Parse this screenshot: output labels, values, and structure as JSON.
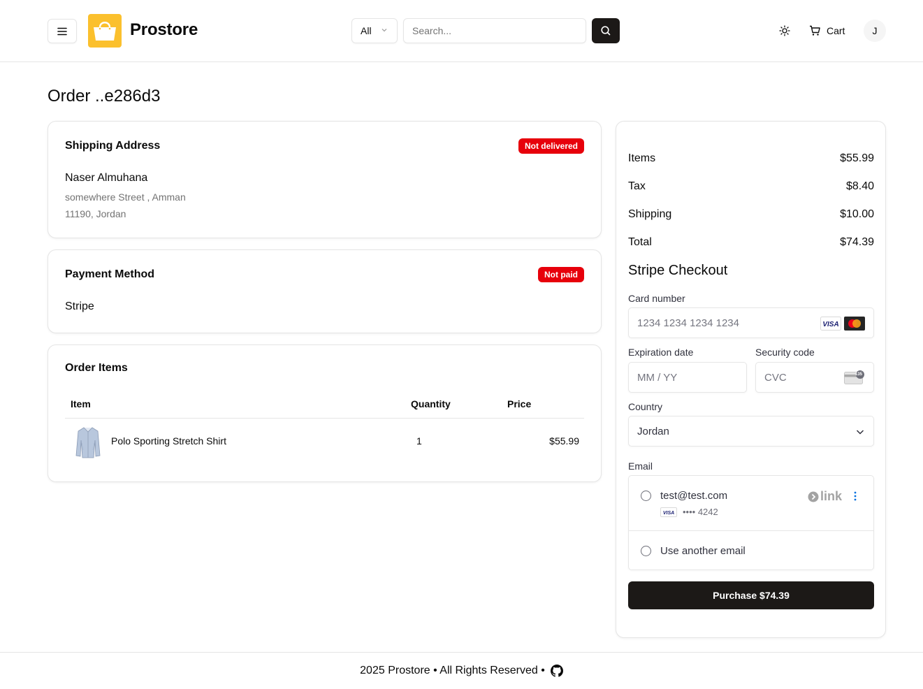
{
  "header": {
    "brand": "Prostore",
    "category_selected": "All",
    "search_placeholder": "Search...",
    "cart_label": "Cart",
    "avatar_initial": "J"
  },
  "page": {
    "title": "Order ..e286d3"
  },
  "shipping": {
    "title": "Shipping Address",
    "status_badge": "Not delivered",
    "name": "Naser Almuhana",
    "address_line1": "somewhere Street , Amman",
    "address_line2": "11190, Jordan"
  },
  "payment": {
    "title": "Payment Method",
    "status_badge": "Not paid",
    "method": "Stripe"
  },
  "order_items": {
    "title": "Order Items",
    "columns": [
      "Item",
      "Quantity",
      "Price"
    ],
    "rows": [
      {
        "name": "Polo Sporting Stretch Shirt",
        "quantity": "1",
        "price": "$55.99"
      }
    ]
  },
  "summary": {
    "rows": [
      {
        "label": "Items",
        "value": "$55.99"
      },
      {
        "label": "Tax",
        "value": "$8.40"
      },
      {
        "label": "Shipping",
        "value": "$10.00"
      },
      {
        "label": "Total",
        "value": "$74.39"
      }
    ]
  },
  "stripe": {
    "title": "Stripe Checkout",
    "card_number_label": "Card number",
    "card_number_placeholder": "1234 1234 1234 1234",
    "expiry_label": "Expiration date",
    "expiry_placeholder": "MM / YY",
    "cvc_label": "Security code",
    "cvc_placeholder": "CVC",
    "country_label": "Country",
    "country_value": "Jordan",
    "email_label": "Email",
    "saved_email": "test@test.com",
    "saved_card_brand": "VISA",
    "saved_card_last4": "•••• 4242",
    "link_logo": "link",
    "other_email_label": "Use another email",
    "cvc_badge": "135",
    "purchase_label": "Purchase $74.39"
  },
  "footer": {
    "text": "2025 Prostore • All Rights Reserved •"
  },
  "colors": {
    "accent_dark": "#1c1917",
    "brand_yellow": "#fbc02d",
    "badge_red": "#e7000b",
    "visa_blue": "#1a1f71"
  }
}
